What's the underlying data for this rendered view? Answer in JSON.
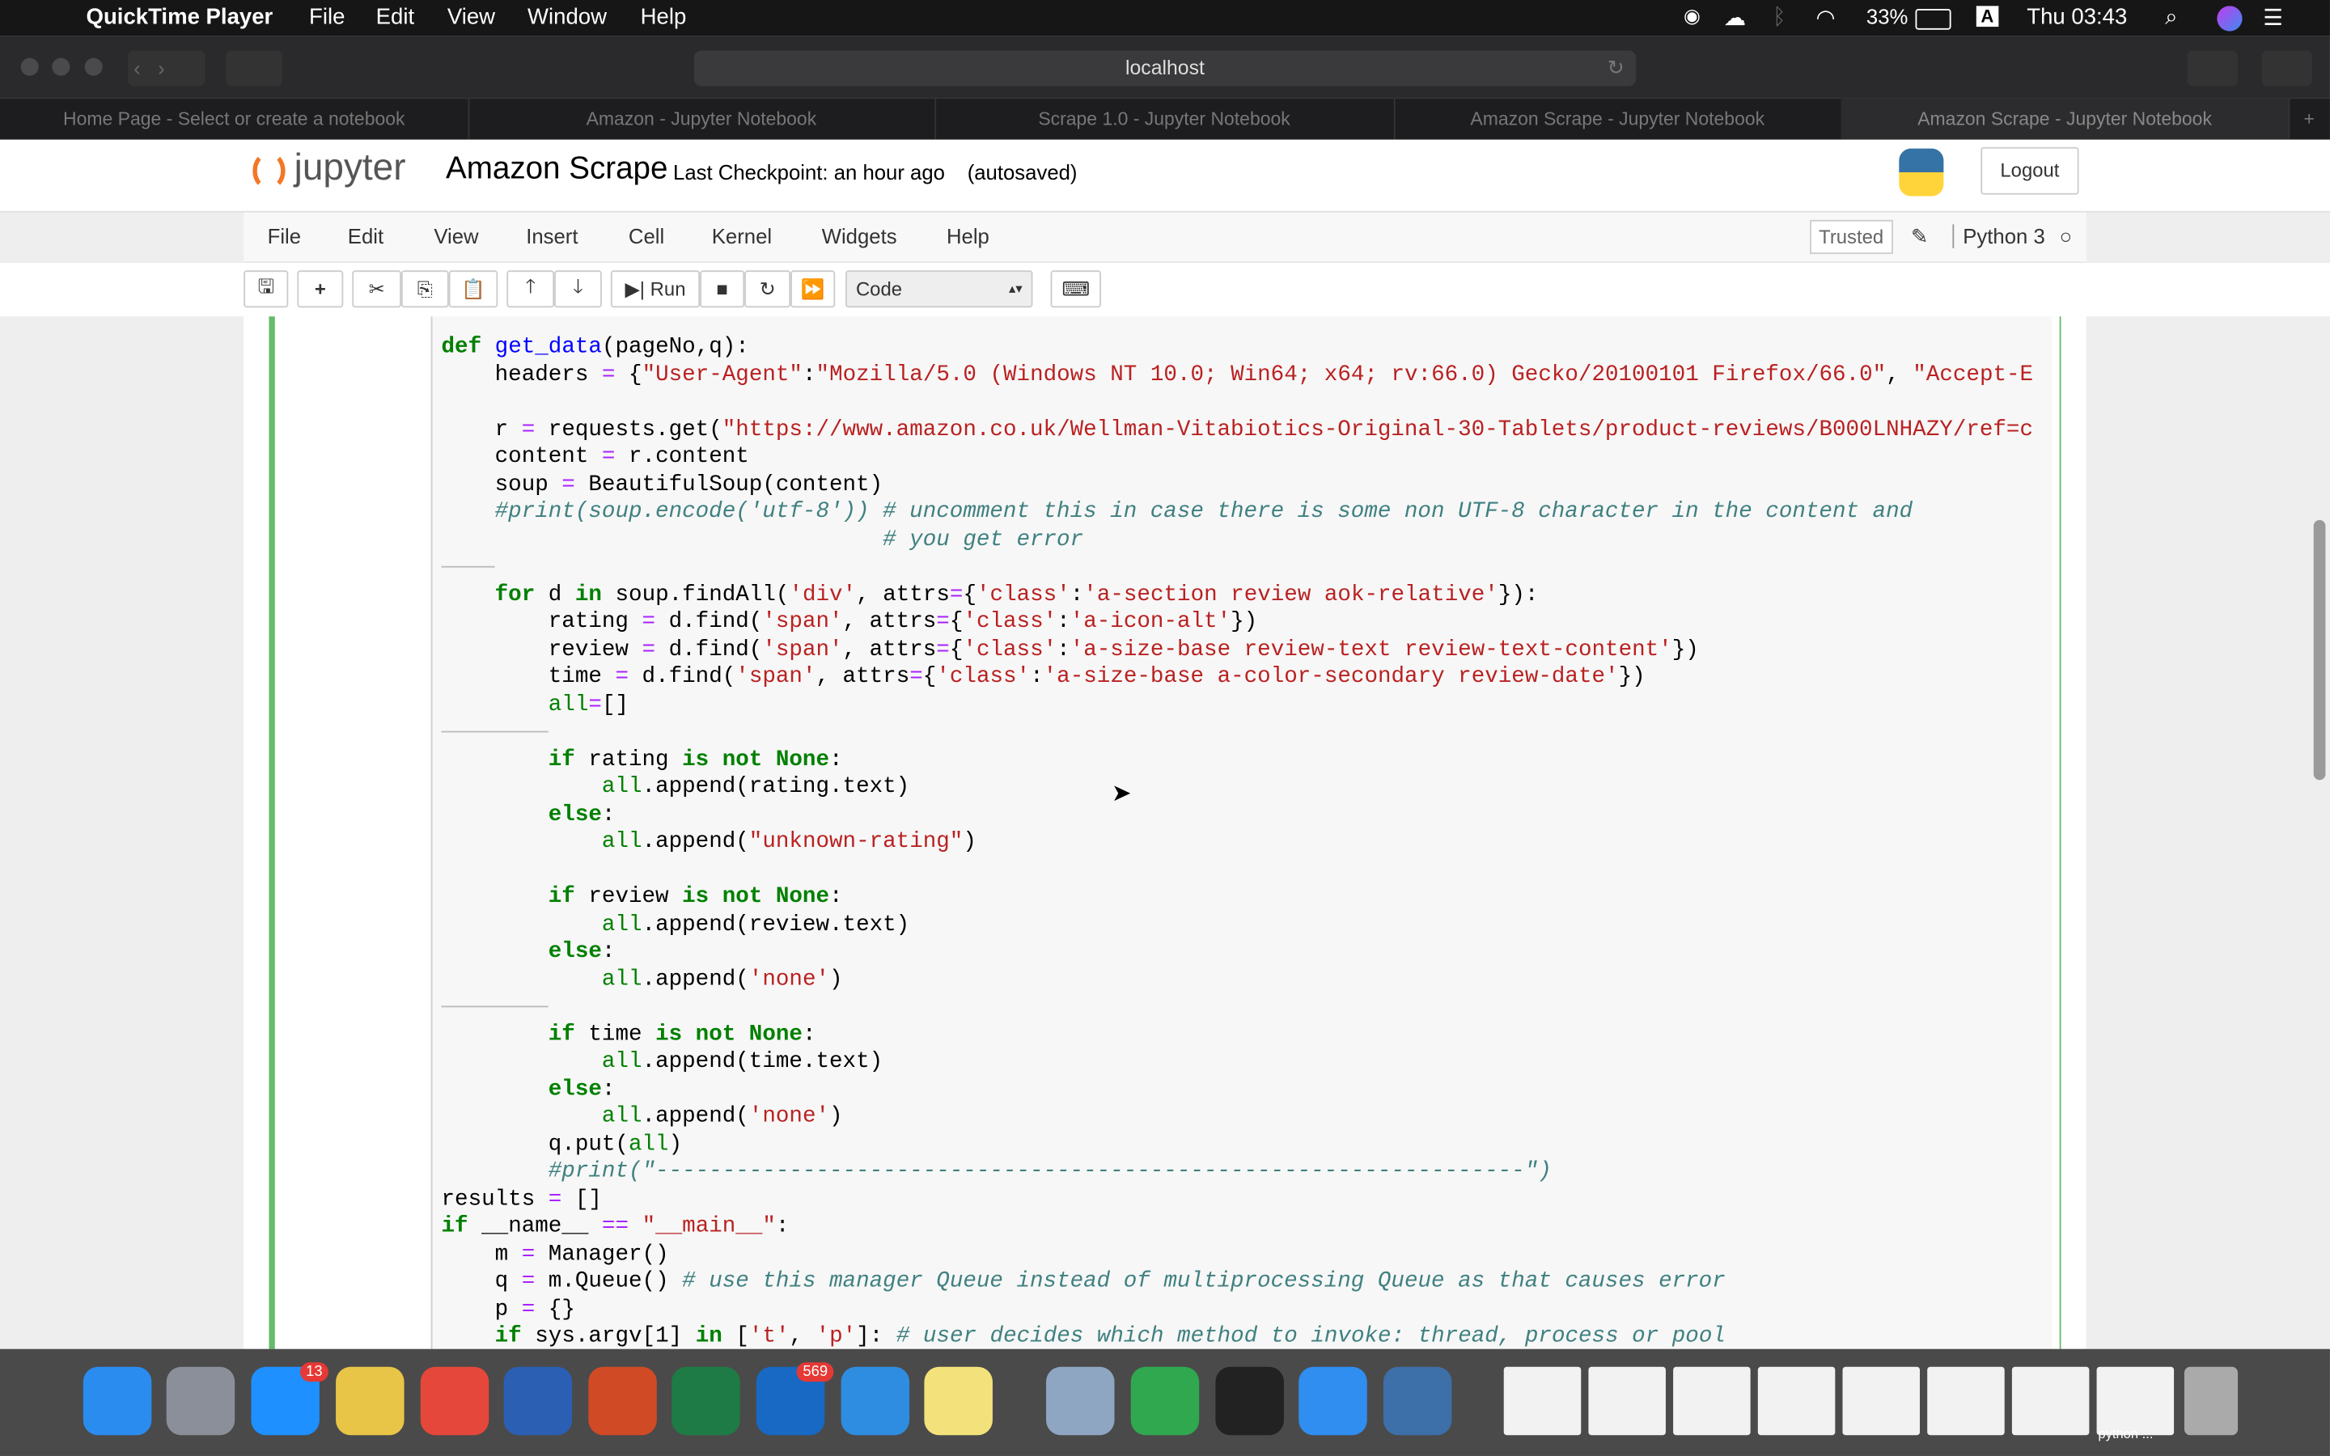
{
  "menubar": {
    "app": "QuickTime Player",
    "items": [
      "File",
      "Edit",
      "View",
      "Window",
      "Help"
    ],
    "battery": "33%",
    "input_source": "A",
    "clock": "Thu 03:43"
  },
  "browser": {
    "url": "localhost",
    "tabs": [
      "Home Page - Select or create a notebook",
      "Amazon - Jupyter Notebook",
      "Scrape 1.0 - Jupyter Notebook",
      "Amazon Scrape - Jupyter Notebook",
      "Amazon Scrape - Jupyter Notebook"
    ]
  },
  "jupyter": {
    "logo": "jupyter",
    "title": "Amazon Scrape",
    "checkpoint": "Last Checkpoint: an hour ago",
    "autosaved": "(autosaved)",
    "logout": "Logout",
    "menu": [
      "File",
      "Edit",
      "View",
      "Insert",
      "Cell",
      "Kernel",
      "Widgets",
      "Help"
    ],
    "trusted": "Trusted",
    "kernel": "Python 3",
    "toolbar": {
      "run": "Run",
      "cell_type": "Code"
    }
  },
  "code_lines": [
    [
      [
        "k",
        "def"
      ],
      [
        "t",
        " "
      ],
      [
        "f",
        "get_data"
      ],
      [
        "t",
        "(pageNo,q):"
      ]
    ],
    [
      [
        "t",
        "    headers "
      ],
      [
        "o",
        "="
      ],
      [
        "t",
        " {"
      ],
      [
        "s",
        "\"User-Agent\""
      ],
      [
        "t",
        ":"
      ],
      [
        "s",
        "\"Mozilla/5.0 (Windows NT 10.0; Win64; x64; rv:66.0) Gecko/20100101 Firefox/66.0\""
      ],
      [
        "t",
        ", "
      ],
      [
        "s",
        "\"Accept-E"
      ]
    ],
    [],
    [
      [
        "t",
        "    r "
      ],
      [
        "o",
        "="
      ],
      [
        "t",
        " requests.get("
      ],
      [
        "s",
        "\"https://www.amazon.co.uk/Wellman-Vitabiotics-Original-30-Tablets/product-reviews/B000LNHAZY/ref=c"
      ]
    ],
    [
      [
        "t",
        "    content "
      ],
      [
        "o",
        "="
      ],
      [
        "t",
        " r.content"
      ]
    ],
    [
      [
        "t",
        "    soup "
      ],
      [
        "o",
        "="
      ],
      [
        "t",
        " BeautifulSoup(content)"
      ]
    ],
    [
      [
        "t",
        "    "
      ],
      [
        "c",
        "#print(soup.encode('utf-8')) # uncomment this in case there is some non UTF-8 character in the content and"
      ]
    ],
    [
      [
        "t",
        "                                 "
      ],
      [
        "c",
        "# you get error"
      ]
    ],
    [
      [
        "m",
        "4"
      ]
    ],
    [
      [
        "t",
        "    "
      ],
      [
        "k",
        "for"
      ],
      [
        "t",
        " d "
      ],
      [
        "k",
        "in"
      ],
      [
        "t",
        " soup.findAll("
      ],
      [
        "s",
        "'div'"
      ],
      [
        "t",
        ", attrs"
      ],
      [
        "o",
        "="
      ],
      [
        "t",
        "{"
      ],
      [
        "s",
        "'class'"
      ],
      [
        "t",
        ":"
      ],
      [
        "s",
        "'a-section review aok-relative'"
      ],
      [
        "t",
        "}):"
      ]
    ],
    [
      [
        "t",
        "        rating "
      ],
      [
        "o",
        "="
      ],
      [
        "t",
        " d.find("
      ],
      [
        "s",
        "'span'"
      ],
      [
        "t",
        ", attrs"
      ],
      [
        "o",
        "="
      ],
      [
        "t",
        "{"
      ],
      [
        "s",
        "'class'"
      ],
      [
        "t",
        ":"
      ],
      [
        "s",
        "'a-icon-alt'"
      ],
      [
        "t",
        "})"
      ]
    ],
    [
      [
        "t",
        "        review "
      ],
      [
        "o",
        "="
      ],
      [
        "t",
        " d.find("
      ],
      [
        "s",
        "'span'"
      ],
      [
        "t",
        ", attrs"
      ],
      [
        "o",
        "="
      ],
      [
        "t",
        "{"
      ],
      [
        "s",
        "'class'"
      ],
      [
        "t",
        ":"
      ],
      [
        "s",
        "'a-size-base review-text review-text-content'"
      ],
      [
        "t",
        "})"
      ]
    ],
    [
      [
        "t",
        "        time "
      ],
      [
        "o",
        "="
      ],
      [
        "t",
        " d.find("
      ],
      [
        "s",
        "'span'"
      ],
      [
        "t",
        ", attrs"
      ],
      [
        "o",
        "="
      ],
      [
        "t",
        "{"
      ],
      [
        "s",
        "'class'"
      ],
      [
        "t",
        ":"
      ],
      [
        "s",
        "'a-size-base a-color-secondary review-date'"
      ],
      [
        "t",
        "})"
      ]
    ],
    [
      [
        "t",
        "        "
      ],
      [
        "b",
        "all"
      ],
      [
        "o",
        "="
      ],
      [
        "t",
        "[]"
      ]
    ],
    [
      [
        "m",
        "8"
      ]
    ],
    [
      [
        "t",
        "        "
      ],
      [
        "k",
        "if"
      ],
      [
        "t",
        " rating "
      ],
      [
        "k",
        "is not None"
      ],
      [
        "t",
        ":"
      ]
    ],
    [
      [
        "t",
        "            "
      ],
      [
        "b",
        "all"
      ],
      [
        "t",
        ".append(rating.text)"
      ]
    ],
    [
      [
        "t",
        "        "
      ],
      [
        "k",
        "else"
      ],
      [
        "t",
        ":"
      ]
    ],
    [
      [
        "t",
        "            "
      ],
      [
        "b",
        "all"
      ],
      [
        "t",
        ".append("
      ],
      [
        "s",
        "\"unknown-rating\""
      ],
      [
        "t",
        ")"
      ]
    ],
    [],
    [
      [
        "t",
        "        "
      ],
      [
        "k",
        "if"
      ],
      [
        "t",
        " review "
      ],
      [
        "k",
        "is not None"
      ],
      [
        "t",
        ":"
      ]
    ],
    [
      [
        "t",
        "            "
      ],
      [
        "b",
        "all"
      ],
      [
        "t",
        ".append(review.text)"
      ]
    ],
    [
      [
        "t",
        "        "
      ],
      [
        "k",
        "else"
      ],
      [
        "t",
        ":"
      ]
    ],
    [
      [
        "t",
        "            "
      ],
      [
        "b",
        "all"
      ],
      [
        "t",
        ".append("
      ],
      [
        "s",
        "'none'"
      ],
      [
        "t",
        ")"
      ]
    ],
    [
      [
        "m",
        "8"
      ]
    ],
    [
      [
        "t",
        "        "
      ],
      [
        "k",
        "if"
      ],
      [
        "t",
        " time "
      ],
      [
        "k",
        "is not None"
      ],
      [
        "t",
        ":"
      ]
    ],
    [
      [
        "t",
        "            "
      ],
      [
        "b",
        "all"
      ],
      [
        "t",
        ".append(time.text)"
      ]
    ],
    [
      [
        "t",
        "        "
      ],
      [
        "k",
        "else"
      ],
      [
        "t",
        ":"
      ]
    ],
    [
      [
        "t",
        "            "
      ],
      [
        "b",
        "all"
      ],
      [
        "t",
        ".append("
      ],
      [
        "s",
        "'none'"
      ],
      [
        "t",
        ")"
      ]
    ],
    [
      [
        "t",
        "        q.put("
      ],
      [
        "b",
        "all"
      ],
      [
        "t",
        ")"
      ]
    ],
    [
      [
        "t",
        "        "
      ],
      [
        "c",
        "#print(\"-----------------------------------------------------------------\")"
      ]
    ],
    [
      [
        "t",
        "results "
      ],
      [
        "o",
        "="
      ],
      [
        "t",
        " []"
      ]
    ],
    [
      [
        "k",
        "if"
      ],
      [
        "t",
        " __name__ "
      ],
      [
        "o",
        "=="
      ],
      [
        "t",
        " "
      ],
      [
        "s",
        "\"__main__\""
      ],
      [
        "t",
        ":"
      ]
    ],
    [
      [
        "t",
        "    m "
      ],
      [
        "o",
        "="
      ],
      [
        "t",
        " Manager()"
      ]
    ],
    [
      [
        "t",
        "    q "
      ],
      [
        "o",
        "="
      ],
      [
        "t",
        " m.Queue() "
      ],
      [
        "c",
        "# use this manager Queue instead of multiprocessing Queue as that causes error"
      ]
    ],
    [
      [
        "t",
        "    p "
      ],
      [
        "o",
        "="
      ],
      [
        "t",
        " {}"
      ]
    ],
    [
      [
        "t",
        "    "
      ],
      [
        "k",
        "if"
      ],
      [
        "t",
        " sys.argv["
      ],
      [
        "t",
        "1"
      ],
      [
        "t",
        "] "
      ],
      [
        "k",
        "in"
      ],
      [
        "t",
        " ["
      ],
      [
        "s",
        "'t'"
      ],
      [
        "t",
        ", "
      ],
      [
        "s",
        "'p'"
      ],
      [
        "t",
        "]: "
      ],
      [
        "c",
        "# user decides which method to invoke: thread, process or pool"
      ]
    ]
  ],
  "dock": {
    "apps": [
      {
        "name": "finder",
        "color": "#2b8cf0"
      },
      {
        "name": "launchpad",
        "color": "#8a8f99"
      },
      {
        "name": "app-store",
        "color": "#1e90ff",
        "badge": "13"
      },
      {
        "name": "python-launcher",
        "color": "#e8c547"
      },
      {
        "name": "chrome",
        "color": "#e5473a"
      },
      {
        "name": "word",
        "color": "#2b5fb4"
      },
      {
        "name": "powerpoint",
        "color": "#d04a26"
      },
      {
        "name": "excel",
        "color": "#1e7b45"
      },
      {
        "name": "outlook",
        "color": "#1769c4",
        "badge": "569"
      },
      {
        "name": "onedrive",
        "color": "#2e8de0"
      },
      {
        "name": "stickies",
        "color": "#f3e27b"
      },
      {
        "name": "preview",
        "color": "#8fa6c2"
      },
      {
        "name": "activity",
        "color": "#2fa84f"
      },
      {
        "name": "terminal",
        "color": "#222222"
      },
      {
        "name": "safari",
        "color": "#2f8ef0"
      },
      {
        "name": "quicktime",
        "color": "#3d6fa8"
      }
    ],
    "window_label": "python ..."
  }
}
